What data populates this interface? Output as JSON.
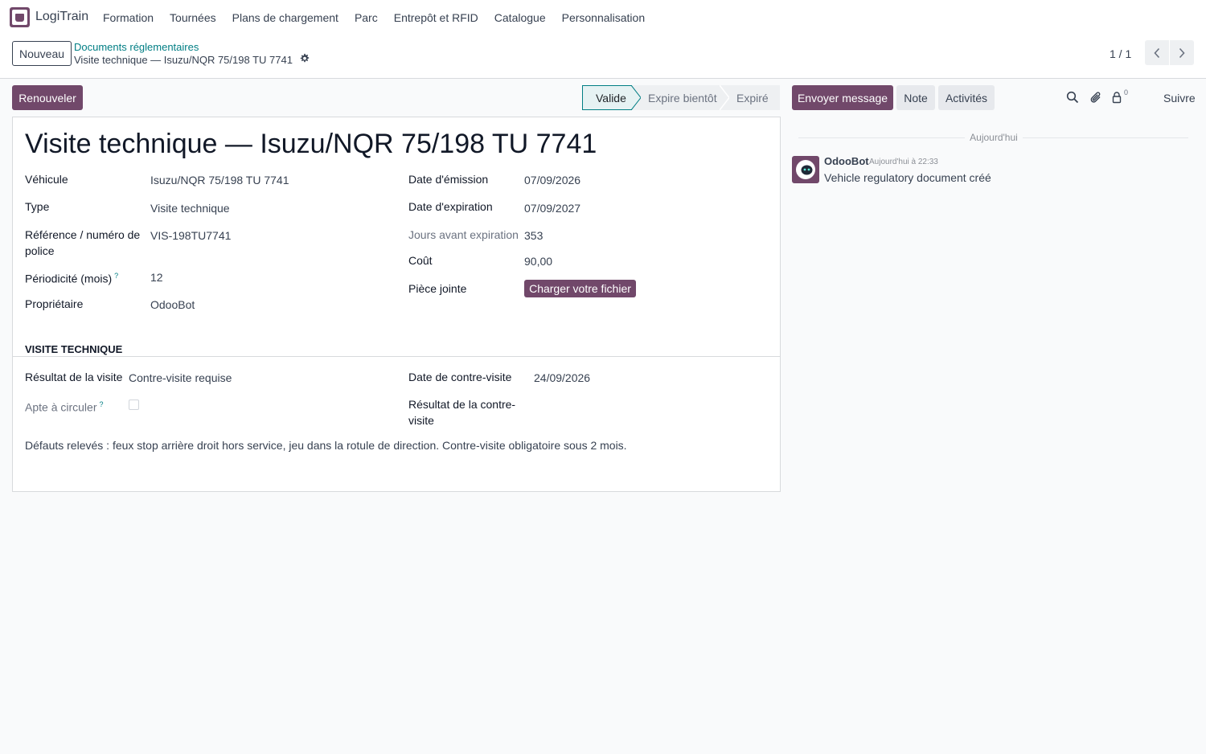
{
  "app": {
    "name": "LogiTrain"
  },
  "menu": [
    {
      "label": "Formation"
    },
    {
      "label": "Tournées"
    },
    {
      "label": "Plans de chargement"
    },
    {
      "label": "Parc"
    },
    {
      "label": "Entrepôt et RFID"
    },
    {
      "label": "Catalogue"
    },
    {
      "label": "Personnalisation"
    }
  ],
  "control": {
    "new_label": "Nouveau",
    "breadcrumb_parent": "Documents réglementaires",
    "breadcrumb_current": "Visite technique — Isuzu/NQR 75/198 TU 7741",
    "pager": "1 / 1"
  },
  "actions": {
    "renew_label": "Renouveler"
  },
  "statusbar": [
    {
      "label": "Valide",
      "active": true
    },
    {
      "label": "Expire bientôt",
      "active": false
    },
    {
      "label": "Expiré",
      "active": false
    }
  ],
  "form": {
    "title": "Visite technique — Isuzu/NQR 75/198 TU 7741",
    "left": {
      "vehicle_label": "Véhicule",
      "vehicle": "Isuzu/NQR 75/198 TU 7741",
      "type_label": "Type",
      "type": "Visite technique",
      "ref_label_1": "Référence / numéro de",
      "ref_label_2": "police",
      "ref": "VIS-198TU7741",
      "period_label": "Périodicité (mois)",
      "period": "12",
      "owner_label": "Propriétaire",
      "owner": "OdooBot"
    },
    "right": {
      "issue_label": "Date d'émission",
      "issue": "07/09/2026",
      "expiry_label": "Date d'expiration",
      "expiry": "07/09/2027",
      "days_label": "Jours avant expiration",
      "days": "353",
      "cost_label": "Coût",
      "cost": "90,00",
      "attach_label": "Pièce jointe",
      "upload_label": "Charger votre fichier"
    },
    "section": {
      "title": "VISITE TECHNIQUE",
      "result_label": "Résultat de la visite",
      "result": "Contre-visite requise",
      "fit_label": "Apte à circuler",
      "fit": false,
      "recheck_date_label": "Date de contre-visite",
      "recheck_date": "24/09/2026",
      "recheck_result_label_1": "Résultat de la contre-",
      "recheck_result_label_2": "visite",
      "notes": "Défauts relevés : feux stop arrière droit hors service, jeu dans la rotule de direction. Contre-visite obligatoire sous 2 mois."
    },
    "help_mark": "?"
  },
  "chatter": {
    "send_label": "Envoyer message",
    "note_label": "Note",
    "activities_label": "Activités",
    "followers_count": "0",
    "follow_label": "Suivre",
    "date_separator": "Aujourd'hui",
    "message": {
      "author": "OdooBot",
      "date": "Aujourd'hui à 22:33",
      "body": "Vehicle regulatory document créé"
    }
  },
  "colors": {
    "brand": "#71486a",
    "link": "#017e84",
    "background": "#f9fafb"
  },
  "icons": [
    "app-logo-icon",
    "gear-icon",
    "chevron-left-icon",
    "chevron-right-icon",
    "search-icon",
    "paperclip-icon",
    "user-lock-icon",
    "odoobot-avatar-icon"
  ]
}
